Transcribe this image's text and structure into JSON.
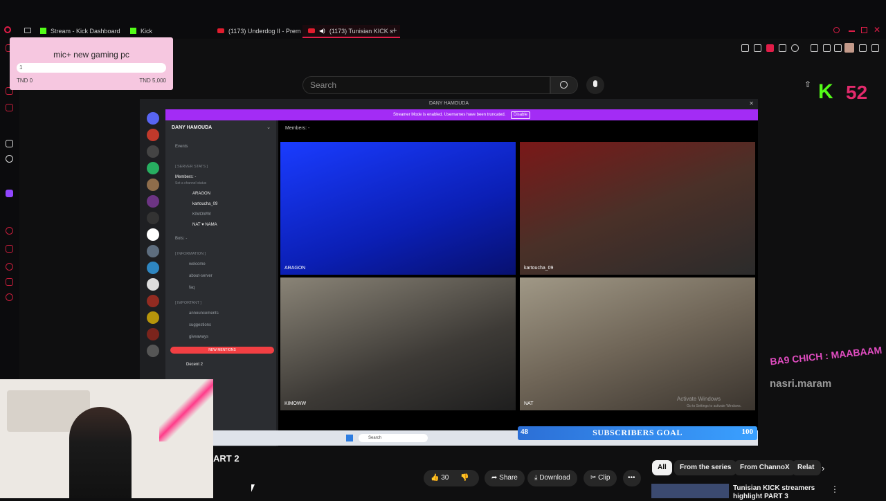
{
  "browser": {
    "tabs": [
      {
        "label": "Stream - Kick Dashboard",
        "icon": "kick-icon"
      },
      {
        "label": "Kick",
        "icon": "kick-icon"
      },
      {
        "label": "(1173) Underdog II - Prem",
        "icon": "youtube-icon"
      },
      {
        "label": "(1173) Tunisian KICK s",
        "icon": "youtube-icon"
      }
    ]
  },
  "goal_widget": {
    "title": "mic+ new gaming pc",
    "current": "1",
    "min": "TND 0",
    "max": "TND 5,000"
  },
  "youtube": {
    "search_placeholder": "Search"
  },
  "stream_overlay": {
    "kick_letter": "K",
    "kick_number": "52",
    "overlay_text_1": "BA9 CHICH : MAABAAM",
    "overlay_text_2": "nasri.maram"
  },
  "discord": {
    "window_title": "DANY HAMOUDA",
    "banner": "Streamer Mode is enabled. Usernames have been truncated.",
    "banner_button": "Disable",
    "server_name": "DANY HAMOUDA",
    "events": "Events",
    "server_stats": "[ SERVER STATS ]",
    "members": "Members: -",
    "members_sub": "Set a channel status",
    "voice_users": [
      "ARAGON",
      "kartoucha_09",
      "KIMOWW",
      "NAT ♥ NAMA"
    ],
    "bots": "Bots: -",
    "information": "[ INFORMATION ]",
    "channels_info": [
      "welcome",
      "about-server",
      "faq"
    ],
    "important": "[ IMPORTANT ]",
    "channels_important": [
      "announcements",
      "suggestions",
      "giveaways"
    ],
    "new_mentions": "NEW MENTIONS",
    "user_panel_name": "Decent 2",
    "voice_header": "Members: -",
    "tiles": [
      "ARAGON",
      "kartoucha_09",
      "KIMOWW",
      "NAT"
    ],
    "activate_windows": "Activate Windows",
    "activate_windows_sub": "Go to Settings to activate Windows.",
    "taskbar_search": "Search"
  },
  "subscribers_goal": {
    "current": "48",
    "label": "SUBSCRIBERS GOAL",
    "target": "100",
    "progress": 0.48
  },
  "video": {
    "title_fragment": "ART 2",
    "likes": "30",
    "share": "Share",
    "download": "Download",
    "clip": "Clip"
  },
  "chips": [
    "All",
    "From the series",
    "From ChannoX",
    "Relat"
  ],
  "related": {
    "title": "Tunisian KICK streamers highlight PART 3"
  },
  "colors": {
    "accent": "#e11d48",
    "kick_green": "#53fc18",
    "discord_purple": "#a32cf5"
  }
}
